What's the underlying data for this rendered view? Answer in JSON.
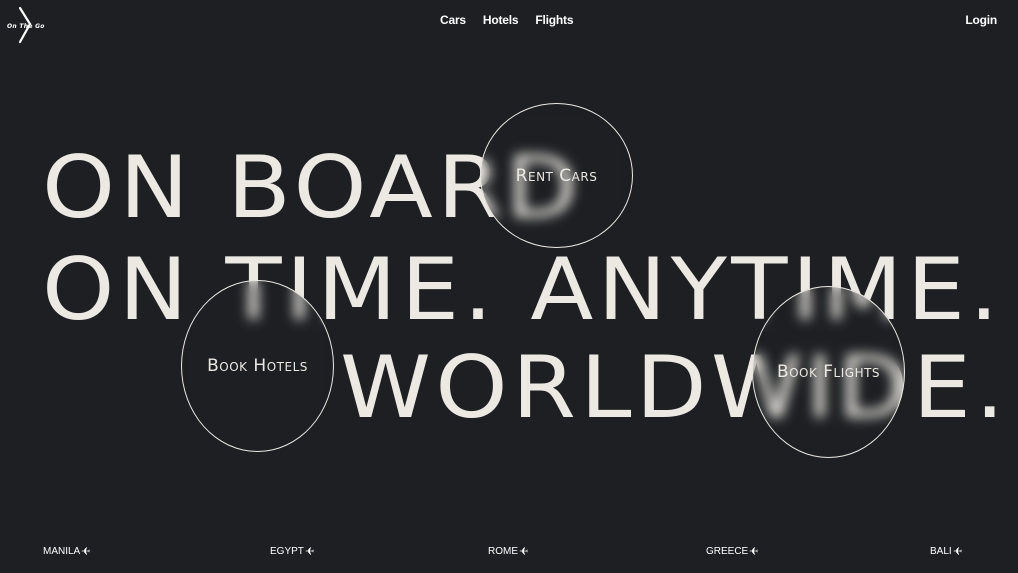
{
  "logo": {
    "text": "On The Go"
  },
  "nav": {
    "items": [
      "Cars",
      "Hotels",
      "Flights"
    ]
  },
  "login_label": "Login",
  "hero": {
    "line1": "ON BOARD",
    "line2": "ON TIME. ANYTIME.",
    "line3": "WORLDWIDE."
  },
  "bubbles": {
    "cars": "Rent Cars",
    "hotels": "Book Hotels",
    "flights": "Book Flights"
  },
  "destinations": [
    "MANILA",
    "EGYPT",
    "ROME",
    "GREECE",
    "BALI"
  ],
  "destination_icon": "airplane-icon",
  "colors": {
    "background": "#1d1f22",
    "text": "#ece9e3"
  }
}
